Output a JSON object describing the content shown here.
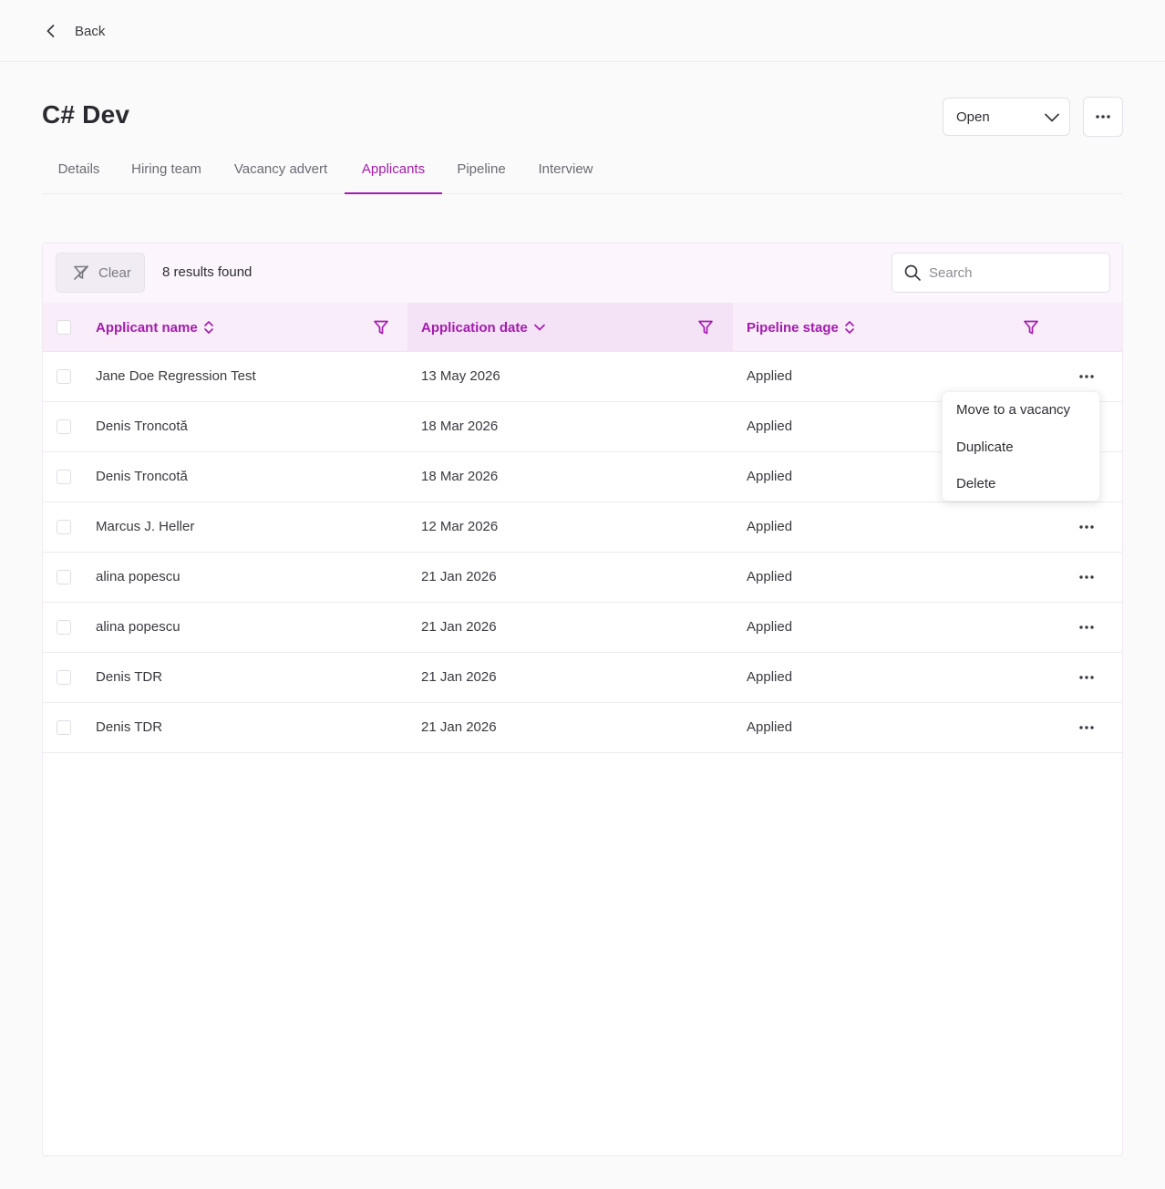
{
  "nav": {
    "back_label": "Back"
  },
  "vacancy": {
    "title": "C# Dev",
    "status": "Open"
  },
  "tabs": [
    {
      "label": "Details"
    },
    {
      "label": "Hiring team"
    },
    {
      "label": "Vacancy advert"
    },
    {
      "label": "Applicants",
      "active": true
    },
    {
      "label": "Pipeline"
    },
    {
      "label": "Interview"
    }
  ],
  "filters": {
    "clear_label": "Clear",
    "results_text": "8 results found",
    "search_placeholder": "Search"
  },
  "table": {
    "columns": [
      {
        "label": "Applicant name",
        "sort": "none"
      },
      {
        "label": "Application date",
        "sort": "desc"
      },
      {
        "label": "Pipeline stage",
        "sort": "none"
      }
    ],
    "rows": [
      {
        "name": "Jane Doe Regression Test",
        "date": "13 May 2026",
        "stage": "Applied"
      },
      {
        "name": "Denis Troncotă",
        "date": "18 Mar 2026",
        "stage": "Applied"
      },
      {
        "name": "Denis Troncotă",
        "date": "18 Mar 2026",
        "stage": "Applied"
      },
      {
        "name": "Marcus J. Heller",
        "date": "12 Mar 2026",
        "stage": "Applied"
      },
      {
        "name": "alina popescu",
        "date": "21 Jan 2026",
        "stage": "Applied"
      },
      {
        "name": "alina popescu",
        "date": "21 Jan 2026",
        "stage": "Applied"
      },
      {
        "name": "Denis TDR",
        "date": "21 Jan 2026",
        "stage": "Applied"
      },
      {
        "name": "Denis TDR",
        "date": "21 Jan 2026",
        "stage": "Applied"
      }
    ]
  },
  "context_menu": {
    "items": [
      {
        "label": "Move to a vacancy"
      },
      {
        "label": "Duplicate"
      },
      {
        "label": "Delete"
      }
    ]
  },
  "colors": {
    "accent": "#a51ab0",
    "header_bg": "#f8edf9",
    "filterbar_bg": "#fcf5fd"
  }
}
